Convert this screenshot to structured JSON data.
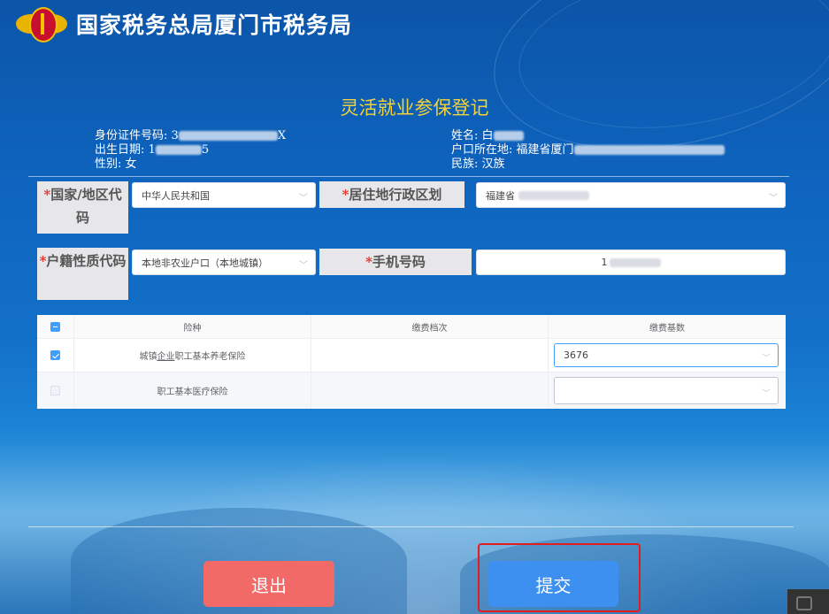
{
  "header": {
    "title": "国家税务总局厦门市税务局"
  },
  "form": {
    "title": "灵活就业参保登记"
  },
  "info": {
    "id_label": "身份证件号码:",
    "id_value_start": "3",
    "id_value_end": "X",
    "birth_label": "出生日期:",
    "birth_value_start": "1",
    "birth_value_end": "5",
    "gender_label": "性别:",
    "gender_value": "女",
    "name_label": "姓名:",
    "name_value_start": "白",
    "hukou_label": "户口所在地:",
    "hukou_value": "福建省厦门",
    "ethnic_label": "民族:",
    "ethnic_value": "汉族"
  },
  "fields": {
    "country_label": "国家/地区代码",
    "country_value": "中华人民共和国",
    "residence_label": "居住地行政区划",
    "residence_value": "福建省",
    "hukou_type_label": "户籍性质代码",
    "hukou_type_value": "本地非农业户口（本地城镇）",
    "phone_label": "手机号码",
    "phone_value": "1",
    "required_mark": "*"
  },
  "table": {
    "headers": [
      "险种",
      "缴费档次",
      "缴费基数"
    ],
    "rows": [
      {
        "insurance": "城镇企业职工基本养老保险",
        "insurance_pre": "城镇",
        "insurance_ul": "企业",
        "insurance_post": "职工基本养老保险",
        "level": "",
        "base": "3676",
        "checked": true
      },
      {
        "insurance": "职工基本医疗保险",
        "level": "",
        "base": "",
        "checked": false
      }
    ]
  },
  "buttons": {
    "exit": "退出",
    "submit": "提交"
  },
  "icons": {
    "dropdown": "chevron-down-icon",
    "emblem": "tax-emblem-icon"
  },
  "colors": {
    "accent_title": "#f2d33a",
    "exit": "#f26a68",
    "submit": "#3d8ff0",
    "highlight": "#e11d1d",
    "required": "#e0302a"
  }
}
